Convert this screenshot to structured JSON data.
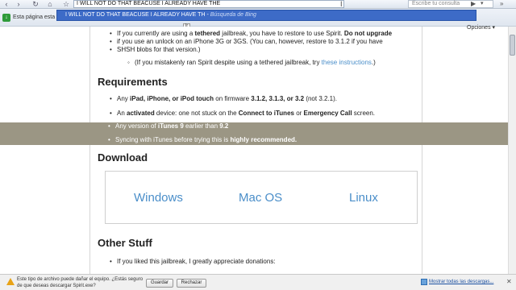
{
  "browser": {
    "address_text": "I WILL NOT DO THAT BEACUSE I ALREADY HAVE THE",
    "search_placeholder": "Escribe tu consulta",
    "tab_title": "Esta página esta",
    "tab_buttons": [
      "Ir"
    ],
    "options_label": "Opciones ▾",
    "autocomplete": {
      "query": "I WILL NOT DO THAT BEACUSE I ALREADY HAVE TH",
      "hint": "Búsqueda de Bing"
    }
  },
  "page": {
    "top_bullets": [
      {
        "parts": [
          {
            "t": "If you currently are using a ",
            "b": false
          },
          {
            "t": "tethered",
            "b": true
          },
          {
            "t": " jailbreak, you have to restore to use Spirit. ",
            "b": false
          },
          {
            "t": "Do not upgrade",
            "b": true
          }
        ]
      }
    ],
    "line2": "if you use an unlock on an iPhone 3G or 3GS. (You can, however, restore to 3.1.2 if you have",
    "line3": "SHSH blobs for that version.)",
    "sub_bullet_pre": "(If you mistakenly ran Spirit despite using a tethered jailbreak, try ",
    "sub_bullet_link": "these instructions",
    "sub_bullet_post": ".)",
    "requirements_heading": "Requirements",
    "req1": {
      "pre": "Any ",
      "b1": "iPad, iPhone, or iPod touch",
      "mid": " on firmware ",
      "b2": "3.1.2, 3.1.3, or 3.2",
      "post": " (not 3.2.1)."
    },
    "req2": {
      "pre": "An ",
      "b1": "activated",
      "mid": " device: one not stuck on the ",
      "b2": "Connect to iTunes",
      "mid2": " or ",
      "b3": "Emergency Call",
      "post": " screen."
    },
    "req3": {
      "pre": "Any version of ",
      "b1": "iTunes 9",
      "mid": " earlier than ",
      "b2": "9.2"
    },
    "req4": {
      "pre": "Syncing with iTunes before trying this is ",
      "b1": "highly recommended."
    },
    "download_heading": "Download",
    "downloads": [
      "Windows",
      "Mac OS",
      "Linux"
    ],
    "other_heading": "Other Stuff",
    "other_bullet": "If you liked this jailbreak, I greatly appreciate donations:"
  },
  "notification": {
    "text": "Este tipo de archivo puede dañar el equipo. ¿Estás seguro de que deseas descargar Spirit.exe?",
    "save_label": "Guardar",
    "reject_label": "Rechazar",
    "show_all": "Mostrar todas las descargas..."
  }
}
